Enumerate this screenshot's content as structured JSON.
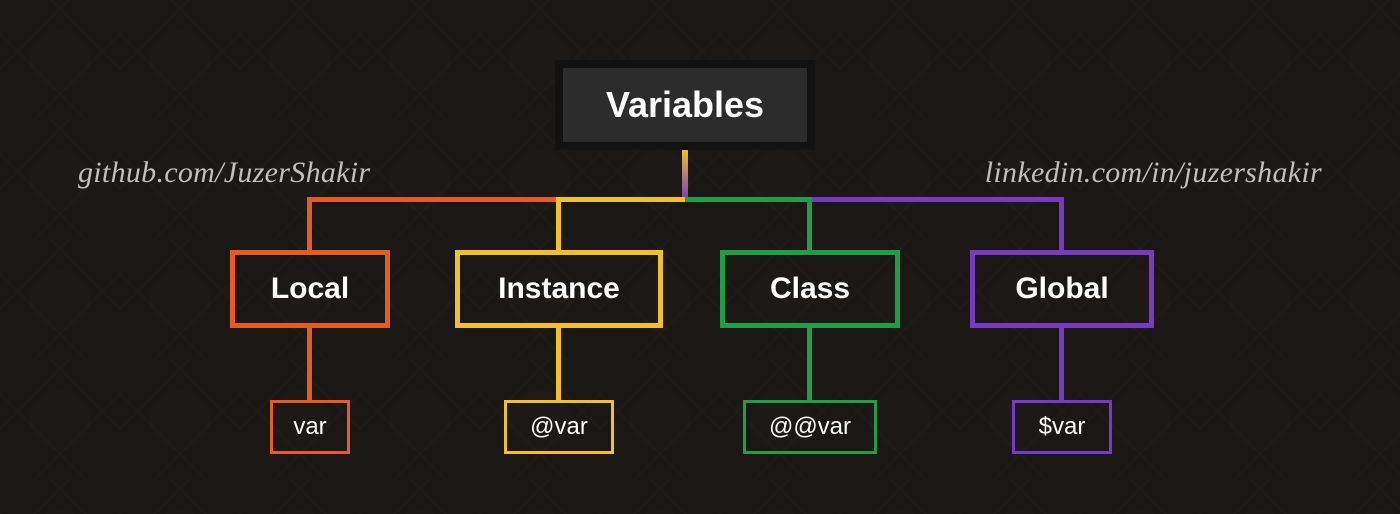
{
  "root": {
    "label": "Variables"
  },
  "links": {
    "left": "github.com/JuzerShakir",
    "right": "linkedin.com/in/juzershakir"
  },
  "types": [
    {
      "name": "Local",
      "example": "var",
      "color": "orange"
    },
    {
      "name": "Instance",
      "example": "@var",
      "color": "yellow"
    },
    {
      "name": "Class",
      "example": "@@var",
      "color": "green"
    },
    {
      "name": "Global",
      "example": "$var",
      "color": "purple"
    }
  ]
}
